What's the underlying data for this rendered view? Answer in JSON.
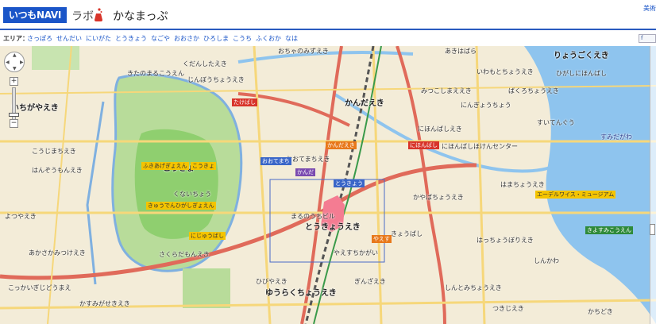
{
  "header": {
    "logo": "いつもNAVI",
    "lab": "ラボ",
    "title": "かなまっぷ",
    "corner_link": "美術"
  },
  "area_bar": {
    "title": "エリア：",
    "links": [
      "さっぽろ",
      "せんだい",
      "にいがた",
      "とうきょう",
      "なごや",
      "おおさか",
      "ひろしま",
      "こうち",
      "ふくおか",
      "なは"
    ]
  },
  "map": {
    "labels": {
      "ichigaya": "いちがやえき",
      "kitanomaru": "きたのまるこうえん",
      "kudan": "くだんしたえき",
      "kanda": "かんだえき",
      "kandaeki_badge": "かんだえき",
      "otemachi": "おおてまちえき",
      "tokyo": "とうきょうえき",
      "nihonbashi": "にほんばしえき",
      "nihonbashi_bank": "にほんばしほけんセンター",
      "kokyo": "こうきょ",
      "fukiage": "ふきあげぎょえん",
      "kokyo_badge": "こうきょ",
      "kyuden": "きゅうでんひがしぎょえん",
      "nijubashi": "にじゅうばし",
      "kunaicho": "くないちょう",
      "hibiya": "ひびやえき",
      "yurakucho": "ゆうらくちょうえき",
      "ginza": "ぎんざえき",
      "kasumigaseki": "かすみがせきえき",
      "sakuradamon": "さくらだもんえき",
      "ryogoku": "りょうごくえき",
      "suitengu": "すいてんぐう",
      "kiyosumi": "きよすみこうえん",
      "hatchobori": "はっちょうぼりえき",
      "museum": "エーデルワイス・ミュージアム",
      "kyobashi": "きょうばし",
      "takebashi": "たけばし",
      "nihonbashi_badge": "にほんばし",
      "hamacho": "はまちょうえき",
      "ningyocho": "にんぎょうちょう",
      "shintomicho": "しんとみちょうえき",
      "marunouchi": "まるのうちビル",
      "yaesu": "やえすちかがい",
      "kayabacho": "かやばちょうえき",
      "ochanomizu": "おちゃのみずえき",
      "akihabara": "あきはばら",
      "iwamotocho": "いわもとちょうえき",
      "jimbocho": "じんぼうちょうえき",
      "hanzomon": "はんぞうもんえき",
      "kojimachi": "こうじまちえき",
      "yotsuya": "よつやえき",
      "akasaka": "あかさかみつけえき",
      "kokkai": "こっかいぎじどうまえ",
      "mitsukoshi": "みつこしまええき",
      "bakuro": "ばくろちょうえき",
      "shinkawa": "しんかわ",
      "kachidoki": "かちどき",
      "tsukiji": "つきじえき",
      "sumida": "すみだがわ",
      "higashi": "ひがしにほんばし",
      "tokyo_badge": "とうきょう",
      "yaesu_badge": "やえす",
      "kanda_badge": "かんだ",
      "otemachi_badge": "おおてまち"
    }
  }
}
